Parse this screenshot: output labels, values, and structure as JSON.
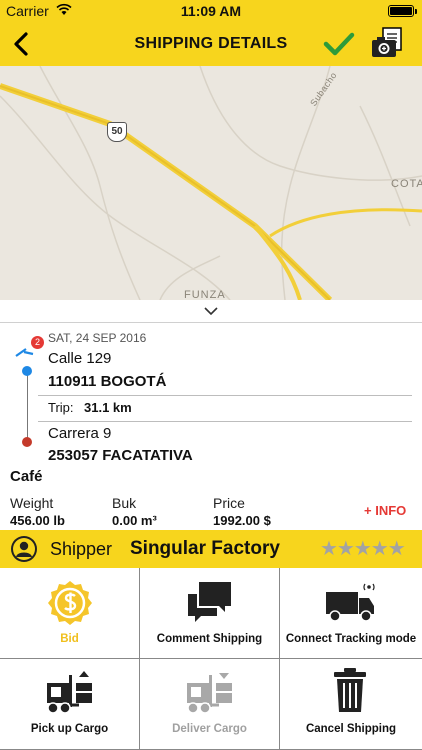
{
  "status_bar": {
    "carrier": "Carrier",
    "time": "11:09 AM"
  },
  "nav": {
    "title": "SHIPPING DETAILS",
    "accent": "#f7d51d"
  },
  "map": {
    "labels": {
      "road_number": "50",
      "place_1": "Subacho",
      "place_2": "COTA",
      "place_3": "FUNZA"
    }
  },
  "route": {
    "date": "SAT, 24 SEP 2016",
    "badge": "2",
    "origin": {
      "street": "Calle 129",
      "city": "110911 BOGOTÁ"
    },
    "trip_label": "Trip:",
    "trip_value": "31.1 km",
    "destination": {
      "street": "Carrera 9",
      "city": "253057 FACATATIVA"
    }
  },
  "cargo": {
    "name": "Café",
    "weight": {
      "label": "Weight",
      "value": "456.00 lb"
    },
    "bulk": {
      "label": "Buk",
      "value": "0.00 m³"
    },
    "price": {
      "label": "Price",
      "value": "1992.00 $"
    },
    "more_info": "+ INFO"
  },
  "shipper": {
    "label": "Shipper",
    "name": "Singular Factory",
    "rating_stars": "★★★★★"
  },
  "actions": {
    "bid": {
      "label": "Bid",
      "icon": "dollar-coin-icon",
      "color": "#f7c31d"
    },
    "comment": {
      "label": "Comment Shipping",
      "icon": "chat-bubbles-icon"
    },
    "tracking": {
      "label": "Connect Tracking mode",
      "icon": "tracking-truck-icon"
    },
    "pickup": {
      "label": "Pick up Cargo",
      "icon": "forklift-up-icon"
    },
    "deliver": {
      "label": "Deliver Cargo",
      "icon": "forklift-down-icon",
      "disabled_color": "#a0a0a0"
    },
    "cancel": {
      "label": "Cancel Shipping",
      "icon": "trash-icon"
    }
  }
}
